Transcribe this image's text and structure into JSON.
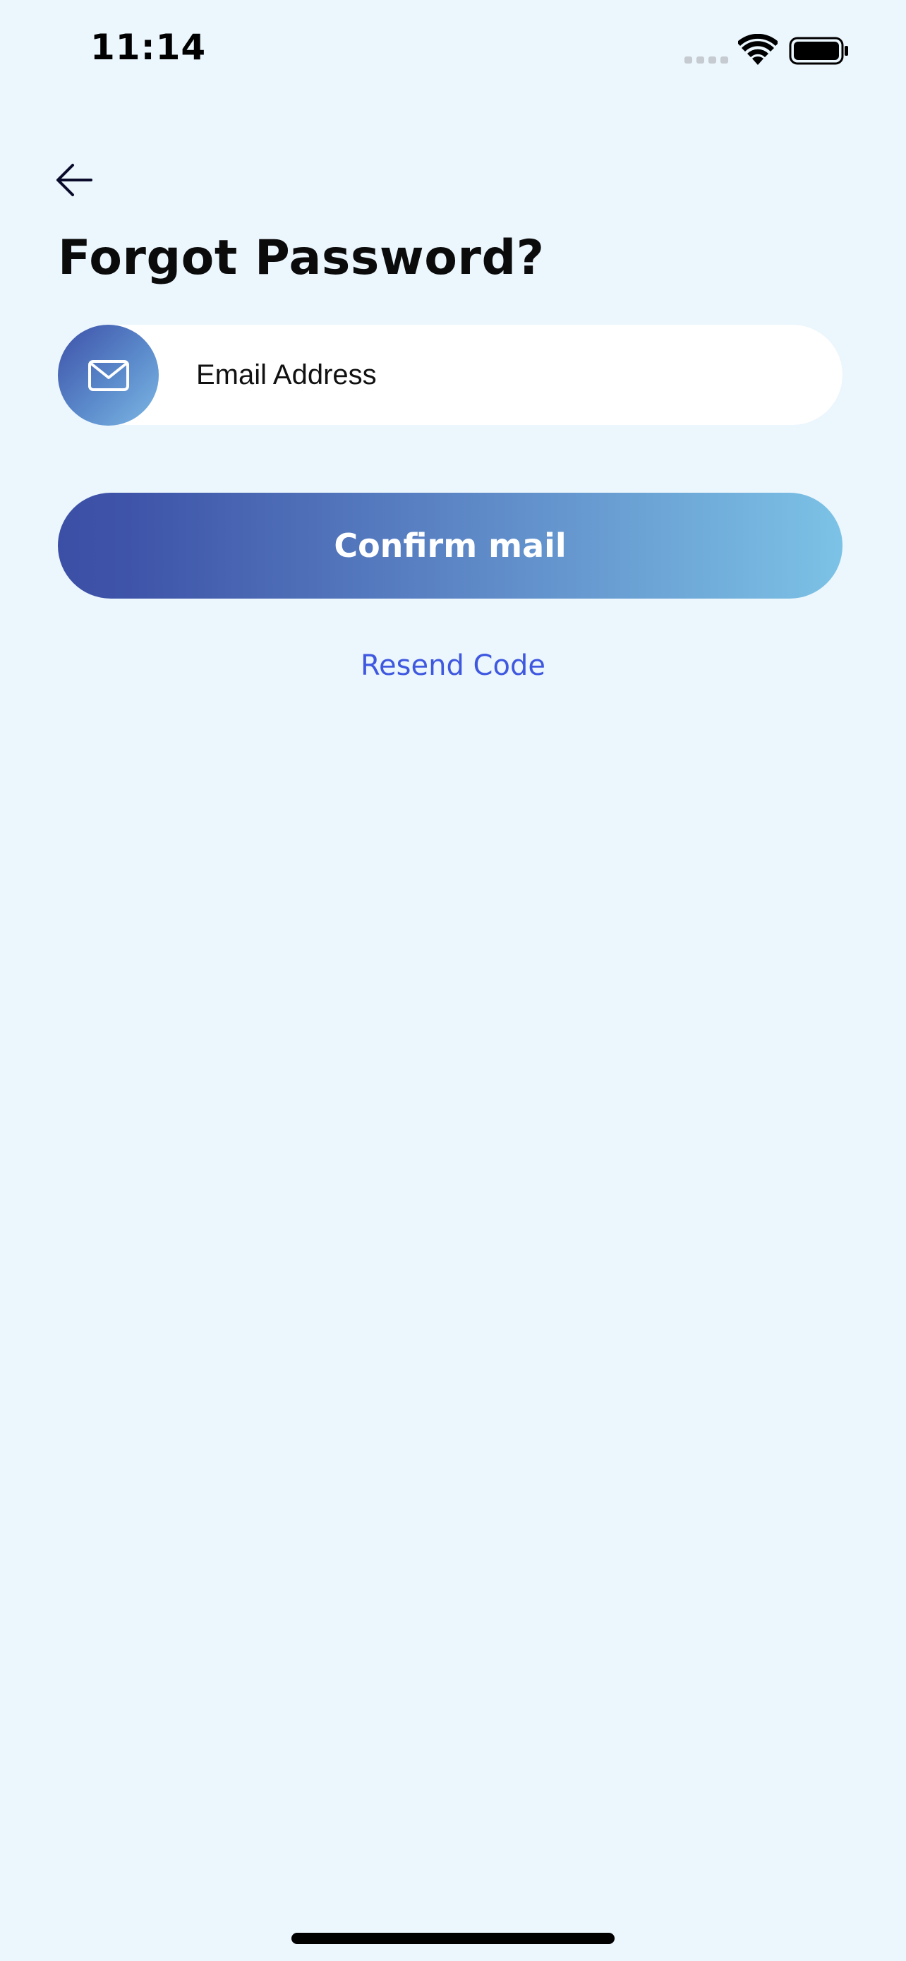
{
  "status_bar": {
    "time": "11:14",
    "icons": [
      "signal-icon",
      "wifi-icon",
      "battery-icon"
    ]
  },
  "header": {
    "back_icon": "arrow-left-icon",
    "title": "Forgot Password?"
  },
  "email_field": {
    "icon": "mail-icon",
    "placeholder": "Email Address",
    "value": ""
  },
  "confirm_button": {
    "label": "Confirm mail"
  },
  "resend_link": {
    "label": "Resend Code"
  },
  "colors": {
    "background": "#EBF6FD",
    "gradient_start": "#3C4FA6",
    "gradient_end": "#7CC2E6",
    "link": "#3F58E0",
    "title": "#0B0B0B"
  }
}
